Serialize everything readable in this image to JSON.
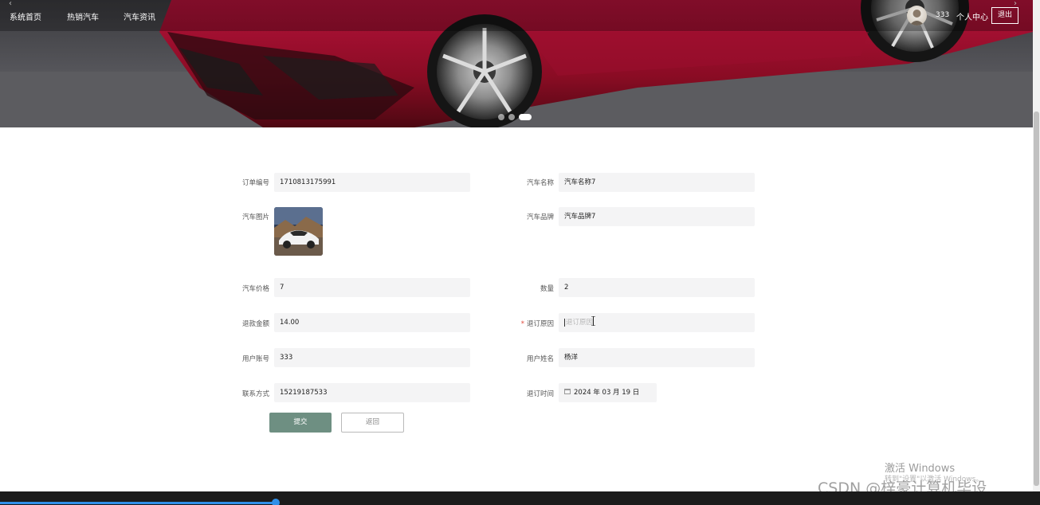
{
  "nav": {
    "items": [
      "系统首页",
      "热销汽车",
      "汽车资讯"
    ],
    "username": "333",
    "center_label": "个人中心",
    "logout_label": "退出"
  },
  "carousel": {
    "slide_count": 3,
    "active_index": 2
  },
  "form": {
    "order_no": {
      "label": "订单编号",
      "value": "1710813175991"
    },
    "car_name": {
      "label": "汽车名称",
      "value": "汽车名称7"
    },
    "car_image": {
      "label": "汽车图片"
    },
    "car_brand": {
      "label": "汽车品牌",
      "value": "汽车品牌7"
    },
    "car_price": {
      "label": "汽车价格",
      "value": "7"
    },
    "quantity": {
      "label": "数量",
      "value": "2"
    },
    "refund_amount": {
      "label": "退款金额",
      "value": "14.00"
    },
    "cancel_reason": {
      "label": "退订原因",
      "placeholder": "退订原因",
      "required": "*"
    },
    "user_account": {
      "label": "用户账号",
      "value": "333"
    },
    "user_name": {
      "label": "用户姓名",
      "value": "杨洋"
    },
    "contact": {
      "label": "联系方式",
      "value": "15219187533"
    },
    "cancel_time": {
      "label": "退订时间",
      "value": "2024 年 03 月 19 日"
    }
  },
  "buttons": {
    "submit": "提交",
    "back": "返回"
  },
  "watermark": {
    "activate_title": "激活 Windows",
    "activate_sub": "转到\"设置\"以激活 Windows。",
    "csdn": "CSDN @梓豪计算机毕设"
  },
  "colors": {
    "submit_bg": "#6e8f82",
    "required": "#e0483a",
    "progress": "#2f8fe8"
  }
}
